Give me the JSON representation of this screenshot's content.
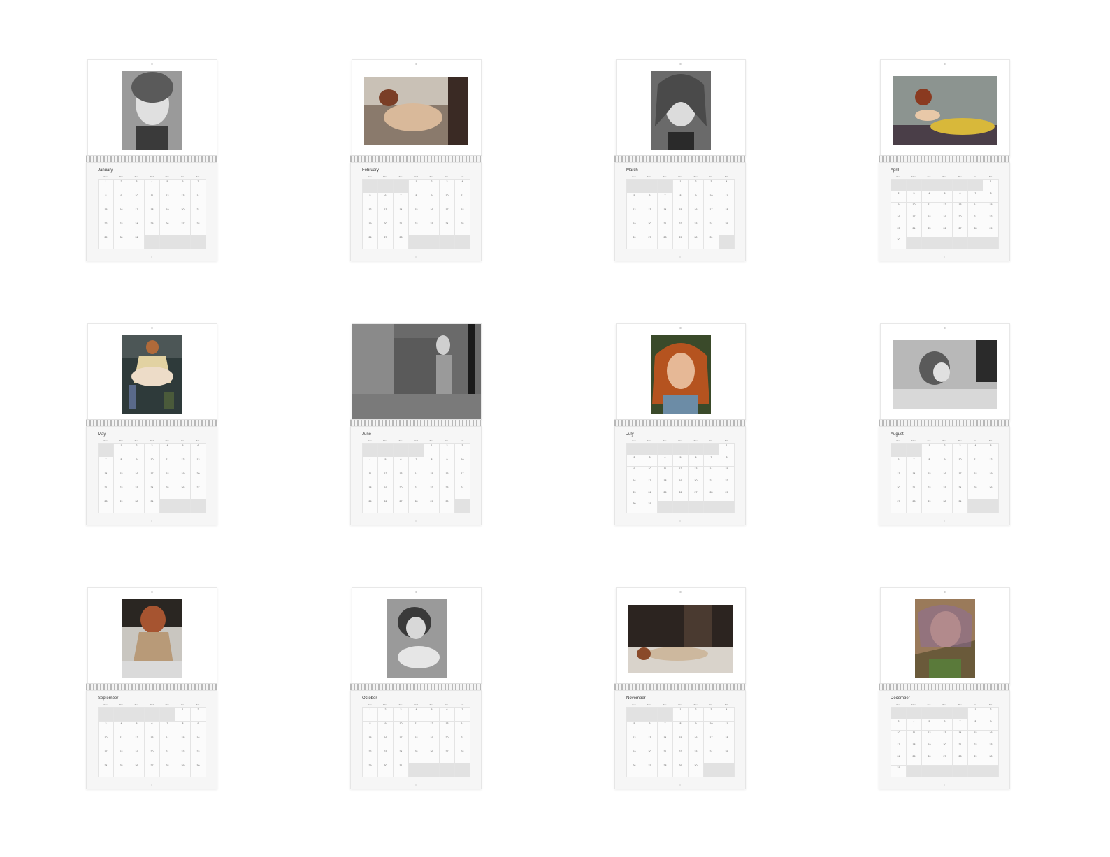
{
  "weekdays": [
    "Sun",
    "Mon",
    "Tue",
    "Wed",
    "Thu",
    "Fri",
    "Sat"
  ],
  "months": [
    {
      "name": "January",
      "photo": "portrait-bw-1",
      "lead": 0,
      "days": 31
    },
    {
      "name": "February",
      "photo": "landscape-color-1",
      "lead": 3,
      "days": 28
    },
    {
      "name": "March",
      "photo": "portrait-bw-2",
      "lead": 3,
      "days": 31
    },
    {
      "name": "April",
      "photo": "landscape-color-2",
      "lead": 6,
      "days": 30
    },
    {
      "name": "May",
      "photo": "portrait-color-1",
      "lead": 1,
      "days": 31
    },
    {
      "name": "June",
      "photo": "landscape-bw-full",
      "lead": 4,
      "days": 30
    },
    {
      "name": "July",
      "photo": "portrait-color-2",
      "lead": 6,
      "days": 31
    },
    {
      "name": "August",
      "photo": "landscape-bw-1",
      "lead": 2,
      "days": 31
    },
    {
      "name": "September",
      "photo": "portrait-color-3",
      "lead": 5,
      "days": 30
    },
    {
      "name": "October",
      "photo": "portrait-bw-3",
      "lead": 0,
      "days": 31
    },
    {
      "name": "November",
      "photo": "landscape-color-3",
      "lead": 3,
      "days": 30
    },
    {
      "name": "December",
      "photo": "portrait-color-4",
      "lead": 5,
      "days": 31
    }
  ]
}
